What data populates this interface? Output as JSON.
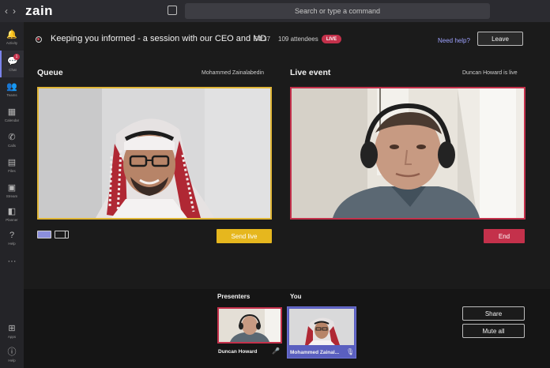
{
  "titlebar": {
    "back_glyph": "‹",
    "forward_glyph": "›",
    "logo_text": "zain",
    "search_placeholder": "Search or type a command"
  },
  "rail": {
    "items": [
      {
        "label": "Activity",
        "icon": "bell-icon",
        "glyph": "🔔"
      },
      {
        "label": "Chat",
        "icon": "chat-icon",
        "glyph": "💬",
        "badge": "1",
        "active": true
      },
      {
        "label": "Teams",
        "icon": "teams-icon",
        "glyph": "👥"
      },
      {
        "label": "Calendar",
        "icon": "calendar-icon",
        "glyph": "▦"
      },
      {
        "label": "Calls",
        "icon": "phone-icon",
        "glyph": "✆"
      },
      {
        "label": "Files",
        "icon": "file-icon",
        "glyph": "▤"
      },
      {
        "label": "Stream",
        "icon": "stream-icon",
        "glyph": "▣"
      },
      {
        "label": "Planner",
        "icon": "planner-icon",
        "glyph": "◧"
      },
      {
        "label": "Help",
        "icon": "help-icon",
        "glyph": "?"
      },
      {
        "label": "",
        "icon": "more-icon",
        "glyph": "···"
      },
      {
        "label": "Apps",
        "icon": "apps-icon",
        "glyph": "⊞"
      },
      {
        "label": "Help",
        "icon": "help-circle-icon",
        "glyph": "ⓘ"
      }
    ]
  },
  "event": {
    "title": "Keeping you informed - a session with our CEO and MD",
    "duration": "54:37",
    "attendees": "109 attendees",
    "live_badge": "LIVE",
    "help_link": "Need help?",
    "leave_label": "Leave"
  },
  "queue": {
    "title": "Queue",
    "presenter_name": "Mohammed Zainalabedin",
    "send_live_label": "Send live"
  },
  "live": {
    "title": "Live event",
    "status": "Duncan Howard is live",
    "end_label": "End"
  },
  "presenters": {
    "title": "Presenters",
    "name": "Duncan Howard"
  },
  "you": {
    "title": "You",
    "name": "Mohammed Zainal..."
  },
  "actions": {
    "share_label": "Share",
    "mute_all_label": "Mute all"
  },
  "colors": {
    "accent": "#6264a7",
    "live_red": "#c4314b",
    "queue_gold": "#e0b637",
    "send_live_gold": "#e6b71e"
  }
}
